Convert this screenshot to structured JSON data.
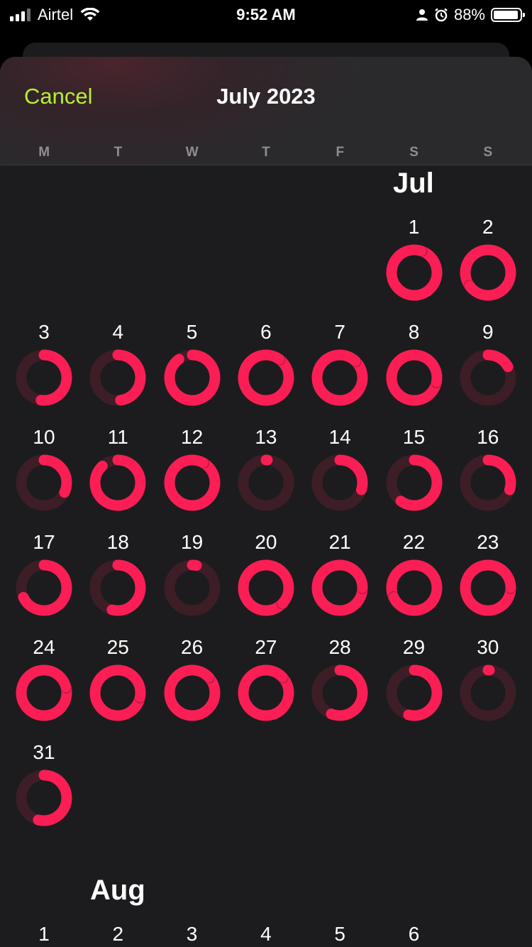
{
  "status_bar": {
    "carrier": "Airtel",
    "time": "9:52 AM",
    "battery_percent": "88%",
    "icons": [
      "signal-icon",
      "wifi-icon",
      "person-icon",
      "alarm-icon",
      "battery-icon"
    ]
  },
  "header": {
    "cancel_label": "Cancel",
    "title": "July 2023",
    "weekdays": [
      "M",
      "T",
      "W",
      "T",
      "F",
      "S",
      "S"
    ]
  },
  "colors": {
    "ring_active": "#fa1e55",
    "ring_track": "#3d1d26",
    "cancel": "#b8f032"
  },
  "july": {
    "label": "Jul",
    "first_weekday_index": 5,
    "days": [
      {
        "day": "1",
        "progress": 1.05
      },
      {
        "day": "2",
        "progress": 1.65
      },
      {
        "day": "3",
        "progress": 0.52
      },
      {
        "day": "4",
        "progress": 0.48
      },
      {
        "day": "5",
        "progress": 0.9
      },
      {
        "day": "6",
        "progress": 1.1
      },
      {
        "day": "7",
        "progress": 1.12
      },
      {
        "day": "8",
        "progress": 1.28
      },
      {
        "day": "9",
        "progress": 0.17
      },
      {
        "day": "10",
        "progress": 0.32
      },
      {
        "day": "11",
        "progress": 0.88
      },
      {
        "day": "12",
        "progress": 1.08
      },
      {
        "day": "13",
        "progress": 0.01
      },
      {
        "day": "14",
        "progress": 0.3
      },
      {
        "day": "15",
        "progress": 0.6
      },
      {
        "day": "16",
        "progress": 0.3
      },
      {
        "day": "17",
        "progress": 0.68
      },
      {
        "day": "18",
        "progress": 0.54
      },
      {
        "day": "19",
        "progress": 0.03
      },
      {
        "day": "20",
        "progress": 1.37
      },
      {
        "day": "21",
        "progress": 1.25
      },
      {
        "day": "22",
        "progress": 1.68
      },
      {
        "day": "23",
        "progress": 1.25
      },
      {
        "day": "24",
        "progress": 1.21
      },
      {
        "day": "25",
        "progress": 1.28
      },
      {
        "day": "26",
        "progress": 1.13
      },
      {
        "day": "27",
        "progress": 1.13
      },
      {
        "day": "28",
        "progress": 0.56
      },
      {
        "day": "29",
        "progress": 0.54
      },
      {
        "day": "30",
        "progress": 0.01
      },
      {
        "day": "31",
        "progress": 0.54
      }
    ]
  },
  "august": {
    "label": "Aug",
    "days": [
      "1",
      "2",
      "3",
      "4",
      "5",
      "6"
    ]
  }
}
